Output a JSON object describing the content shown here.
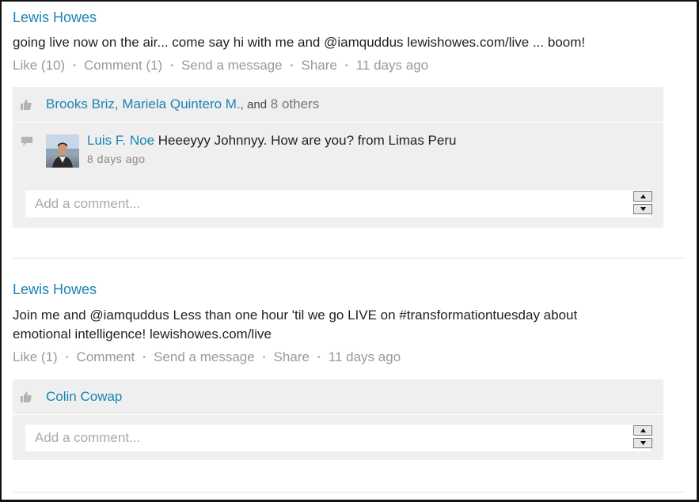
{
  "posts": [
    {
      "author": "Lewis Howes",
      "text_line1": "going live now on the air... come say hi with me and @iamquddus lewishowes.com/live ... boom!",
      "actions": {
        "like": "Like (10)",
        "comment": "Comment (1)",
        "message": "Send a message",
        "share": "Share",
        "time": "11 days ago"
      },
      "likers": {
        "name1": "Brooks Briz",
        "sep": ",",
        "name2": "Mariela Quintero M.",
        "and": ", and",
        "others": "8 others"
      },
      "comment": {
        "author": "Luis F. Noe",
        "text": "Heeeyyy Johnnyy. How are you? from Limas Peru",
        "time": "8 days ago"
      },
      "add_comment_placeholder": "Add a comment..."
    },
    {
      "author": "Lewis Howes",
      "text_line1": "Join me and @iamquddus Less than one hour 'til we go LIVE on #transformationtuesday about",
      "text_line2": "emotional intelligence! lewishowes.com/live",
      "actions": {
        "like": "Like (1)",
        "comment": "Comment",
        "message": "Send a message",
        "share": "Share",
        "time": "11 days ago"
      },
      "likers": {
        "name1": "Colin Cowap"
      },
      "add_comment_placeholder": "Add a comment..."
    }
  ],
  "icons": {
    "like": "thumbs-up-icon",
    "comment": "speech-bubble-icon",
    "spin_up": "arrow-up-icon",
    "spin_down": "arrow-down-icon"
  },
  "colors": {
    "link": "#1a84b3",
    "panel_bg": "#efefef",
    "muted_text": "#999999"
  }
}
